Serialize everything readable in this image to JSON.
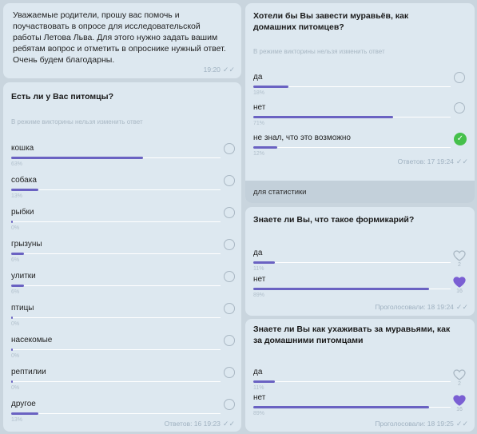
{
  "intro": {
    "text": "Уважаемые родители, прошу вас помочь и поучаствовать в опросе для исследовательской работы Летова Льва. Для этого нужно задать вашим ребятам вопрос и отметить в опроснике нужный ответ. Очень будем благодарны.",
    "time": "19:20",
    "ticks": "✓✓"
  },
  "poll1": {
    "question": "Есть ли у Вас питомцы?",
    "hint": "В режиме викторины нельзя изменить ответ",
    "options": [
      {
        "label": "кошка",
        "percent": "63%",
        "value": 63
      },
      {
        "label": "собака",
        "percent": "13%",
        "value": 13
      },
      {
        "label": "рыбки",
        "percent": "0%",
        "value": 0
      },
      {
        "label": "грызуны",
        "percent": "6%",
        "value": 6
      },
      {
        "label": "улитки",
        "percent": "6%",
        "value": 6
      },
      {
        "label": "птицы",
        "percent": "0%",
        "value": 0
      },
      {
        "label": "насекомые",
        "percent": "0%",
        "value": 0
      },
      {
        "label": "рептилии",
        "percent": "0%",
        "value": 0
      },
      {
        "label": "другое",
        "percent": "13%",
        "value": 13
      }
    ],
    "footer": "Ответов: 16  19:23",
    "ticks": "✓✓"
  },
  "poll2": {
    "question": "Хотели бы Вы завести муравьёв, как домашних питомцев?",
    "hint": "В режиме викторины нельзя изменить ответ",
    "options": [
      {
        "label": "да",
        "percent": "18%",
        "value": 18
      },
      {
        "label": "нет",
        "percent": "71%",
        "value": 71
      },
      {
        "label": "не знал, что это возможно",
        "percent": "12%",
        "value": 12,
        "selected": true
      }
    ],
    "footer": "Ответов: 17  19:24",
    "ticks": "✓✓",
    "caption": "для статистики"
  },
  "poll3": {
    "question": "Знаете ли Вы, что такое формикарий?",
    "options": [
      {
        "label": "да",
        "percent": "11%",
        "value": 11,
        "votes": "2",
        "liked": false
      },
      {
        "label": "нет",
        "percent": "89%",
        "value": 89,
        "votes": "16",
        "liked": true
      }
    ],
    "footer": "Проголосовали: 18  19:24",
    "ticks": "✓✓"
  },
  "poll4": {
    "question": "Знаете ли Вы как ухаживать за муравьями, как за домашними питомцами",
    "options": [
      {
        "label": "да",
        "percent": "11%",
        "value": 11,
        "votes": "2",
        "liked": false
      },
      {
        "label": "нет",
        "percent": "89%",
        "value": 89,
        "votes": "16",
        "liked": true
      }
    ],
    "footer": "Проголосовали: 18  19:25",
    "ticks": "✓✓"
  },
  "colors": {
    "bubble": "#dde8f0",
    "bar": "#6a62c2",
    "check": "#45c04b",
    "heart": "#7a5fd3"
  }
}
